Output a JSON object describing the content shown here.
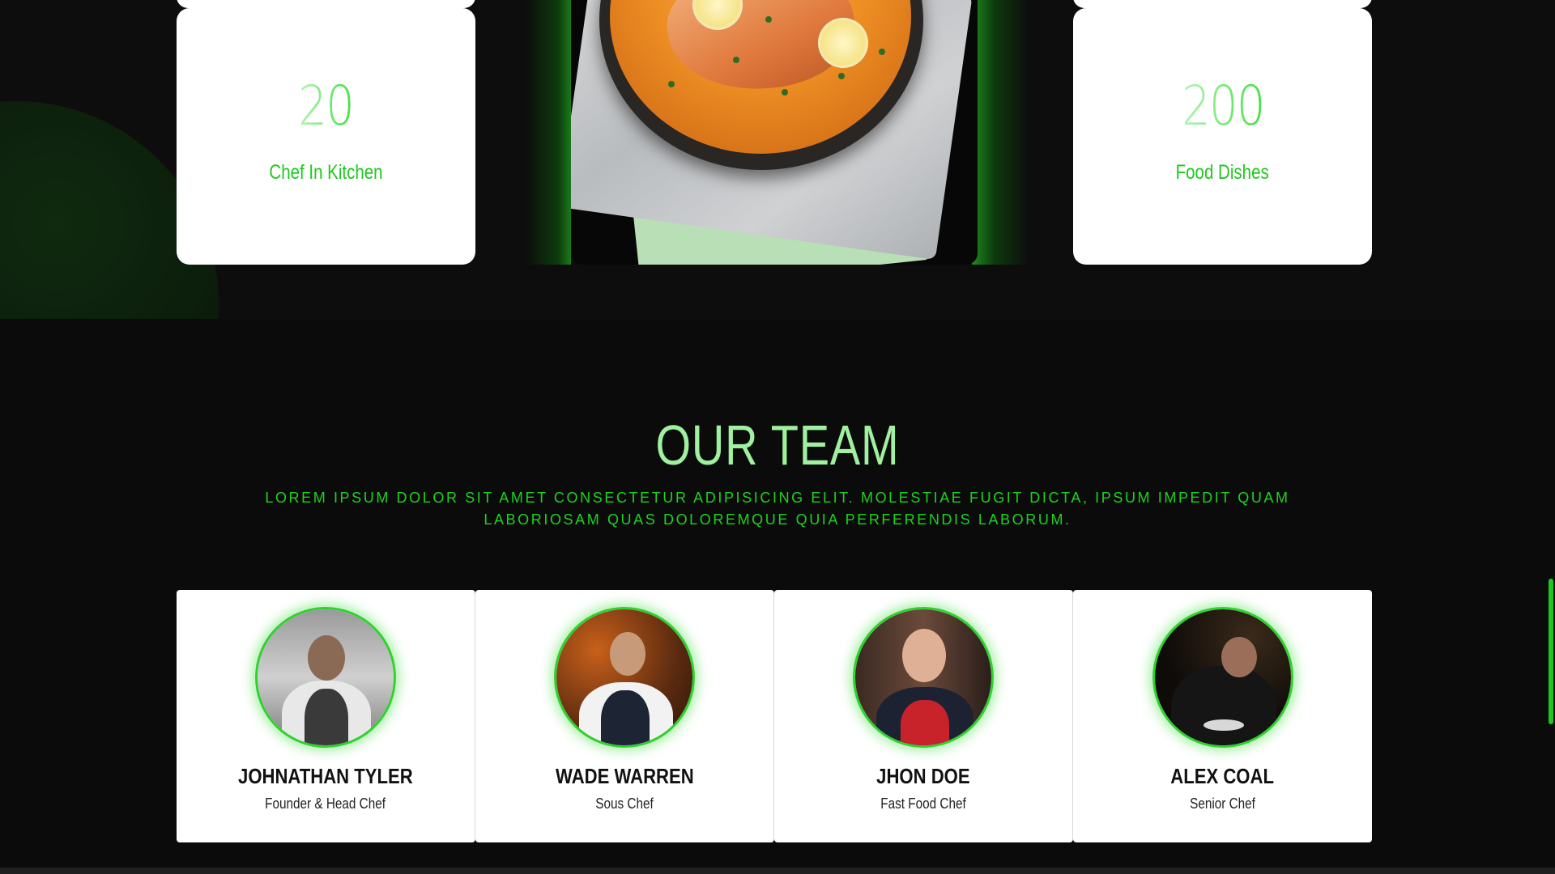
{
  "stats": [
    {
      "number": "20",
      "label": "Chef In Kitchen"
    },
    {
      "number": "200",
      "label": "Food Dishes"
    }
  ],
  "team_section": {
    "title": "OUR TEAM",
    "subtitle": "Lorem ipsum dolor sit amet consectetur adipisicing elit. Molestiae fugit dicta, ipsum impedit quam laboriosam quas doloremque quia perferendis laborum."
  },
  "team": [
    {
      "name": "JOHNATHAN TYLER",
      "role": "Founder & Head Chef"
    },
    {
      "name": "WADE WARREN",
      "role": "Sous Chef"
    },
    {
      "name": "JHON DOE",
      "role": "Fast Food Chef"
    },
    {
      "name": "ALEX COAL",
      "role": "Senior Chef"
    }
  ],
  "colors": {
    "accent_green": "#1ec81e",
    "title_green": "#9ff09f",
    "background": "#0b0b0b",
    "card": "#ffffff"
  }
}
